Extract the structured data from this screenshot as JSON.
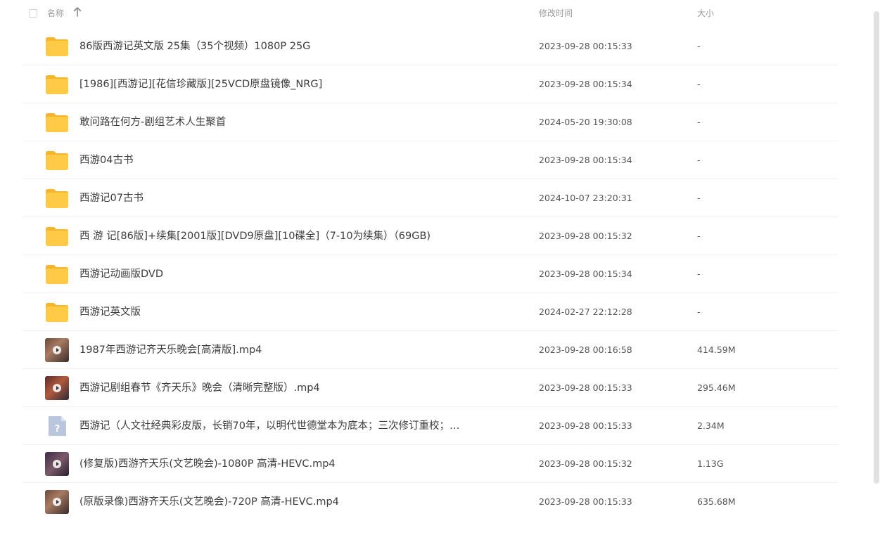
{
  "header": {
    "name_label": "名称",
    "time_label": "修改时间",
    "size_label": "大小",
    "sort_icon": "arrow-up-icon"
  },
  "files": [
    {
      "name": "86版西游记英文版 25集（35个视频）1080P 25G",
      "time": "2023-09-28 00:15:33",
      "size": "-",
      "type": "folder"
    },
    {
      "name": "[1986][西游记][花信珍藏版][25VCD原盘镜像_NRG]",
      "time": "2023-09-28 00:15:34",
      "size": "-",
      "type": "folder"
    },
    {
      "name": "敢问路在何方-剧组艺术人生聚首",
      "time": "2024-05-20 19:30:08",
      "size": "-",
      "type": "folder"
    },
    {
      "name": "西游04古书",
      "time": "2023-09-28 00:15:34",
      "size": "-",
      "type": "folder"
    },
    {
      "name": "西游记07古书",
      "time": "2024-10-07 23:20:31",
      "size": "-",
      "type": "folder"
    },
    {
      "name": "西 游 记[86版]+续集[2001版][DVD9原盘][10碟全]（7-10为续集）（69GB)",
      "time": "2023-09-28 00:15:32",
      "size": "-",
      "type": "folder"
    },
    {
      "name": "西游记动画版DVD",
      "time": "2023-09-28 00:15:34",
      "size": "-",
      "type": "folder"
    },
    {
      "name": "西游记英文版",
      "time": "2024-02-27 22:12:28",
      "size": "-",
      "type": "folder"
    },
    {
      "name": "1987年西游记齐天乐晚会[高清版].mp4",
      "time": "2023-09-28 00:16:58",
      "size": "414.59M",
      "type": "video"
    },
    {
      "name": "西游记剧组春节《齐天乐》晚会（清晰完整版）.mp4",
      "time": "2023-09-28 00:15:33",
      "size": "295.46M",
      "type": "video"
    },
    {
      "name": "西游记（人文社经典彩皮版，长销70年，以明代世德堂本为底本；三次修订重校；…",
      "time": "2023-09-28 00:15:33",
      "size": "2.34M",
      "type": "unknown"
    },
    {
      "name": "(修复版)西游齐天乐(文艺晚会)-1080P 高清-HEVC.mp4",
      "time": "2023-09-28 00:15:32",
      "size": "1.13G",
      "type": "video"
    },
    {
      "name": "(原版录像)西游齐天乐(文艺晚会)-720P 高清-HEVC.mp4",
      "time": "2023-09-28 00:15:33",
      "size": "635.68M",
      "type": "video"
    }
  ],
  "colors": {
    "folder": "#FFCB47",
    "folder_tab": "#F7B52C",
    "divider": "#F1F2F4",
    "header_text": "#9A9A9A"
  }
}
